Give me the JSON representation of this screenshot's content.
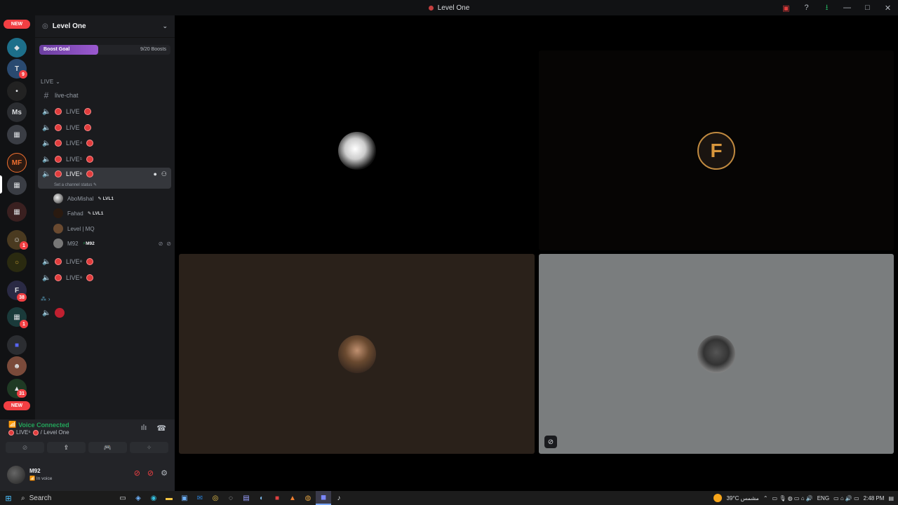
{
  "window": {
    "title": "Level One",
    "controls": [
      "minimize",
      "maximize",
      "close"
    ]
  },
  "guild_rail": {
    "new_label_top": "NEW",
    "new_label_bottom": "NEW",
    "server_ms": "Ms",
    "server_mf": "MF",
    "badges": [
      "9",
      "1",
      "38",
      "1",
      "31"
    ]
  },
  "server": {
    "name": "Level One",
    "boost_label": "Boost Goal",
    "boost_count": "9/20 Boosts",
    "boost_progress": 0.45
  },
  "category": "LIVE",
  "text_channel": "live-chat",
  "voice_channels": [
    "LIVE",
    "LIVE",
    "LIVE⁴",
    "LIVE⁵",
    "LIVE⁶",
    "LIVE⁸",
    "LIVE⁹"
  ],
  "active_channel_status": "Set a channel status",
  "members": [
    {
      "name": "AboMishal",
      "tag": "LVL1"
    },
    {
      "name": "Fahad",
      "tag": "LVL1"
    },
    {
      "name": "Level | MQ",
      "tag": ""
    },
    {
      "name": "M92",
      "tag": "M92"
    }
  ],
  "user_panel": {
    "voice_status": "Voice Connected",
    "channel_ref": "LIVE⁶",
    "server_ref": "/ Level One",
    "username": "M92",
    "user_status": "In voice"
  },
  "taskbar": {
    "search": "Search",
    "weather": "39°C  مشمس",
    "lang": "ENG",
    "time": "2:48 PM"
  },
  "colors": {
    "live_red": "#e03c3c",
    "voice_green": "#23a55a",
    "boost_purple": "#9b59d0"
  }
}
